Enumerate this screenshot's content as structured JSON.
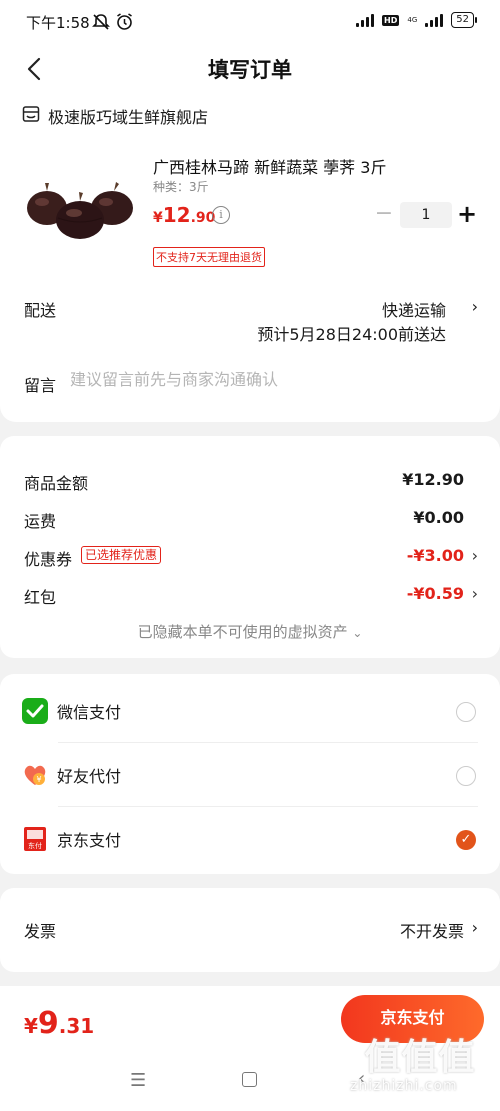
{
  "status_bar": {
    "time": "下午1:58",
    "net": "4G",
    "battery": "52"
  },
  "header": {
    "title": "填写订单"
  },
  "shop": {
    "name": "极速版巧域生鲜旗舰店"
  },
  "product": {
    "title": "广西桂林马蹄 新鲜蔬菜 荸荠 3斤",
    "spec": "种类：3斤",
    "price_currency": "¥",
    "price_int": "12",
    "price_dec": ".90",
    "info_symbol": "i",
    "quantity": "1",
    "minus": "−",
    "plus": "+",
    "tag": "不支持7天无理由退货"
  },
  "delivery": {
    "label": "配送",
    "method": "快递运输",
    "eta": "预计5月28日24:00前送达"
  },
  "note": {
    "label": "留言",
    "placeholder": "建议留言前先与商家沟通确认"
  },
  "costs": {
    "goods_label": "商品金额",
    "goods_value": "¥12.90",
    "shipping_label": "运费",
    "shipping_value": "¥0.00",
    "coupon_label": "优惠券",
    "coupon_tag": "已选推荐优惠",
    "coupon_value": "-¥3.00",
    "redpacket_label": "红包",
    "redpacket_value": "-¥0.59",
    "hidden_assets": "已隐藏本单不可使用的虚拟资产"
  },
  "payment": {
    "options": [
      {
        "label": "微信支付",
        "icon": "wechat-pay-icon",
        "selected": false
      },
      {
        "label": "好友代付",
        "icon": "friend-pay-icon",
        "selected": false
      },
      {
        "label": "京东支付",
        "icon": "jd-pay-icon",
        "selected": true
      }
    ],
    "jd_icon_text": "东付"
  },
  "invoice": {
    "label": "发票",
    "value": "不开发票"
  },
  "footer": {
    "total_currency": "¥",
    "total_int": "9",
    "total_dec": ".31",
    "pay_button": "京东支付",
    "watermark": "值值值",
    "watermark_sub": "zhizhizhi.com"
  },
  "colors": {
    "accent": "#e2231a",
    "button_start": "#f2371e",
    "button_end": "#fe6a2b"
  }
}
